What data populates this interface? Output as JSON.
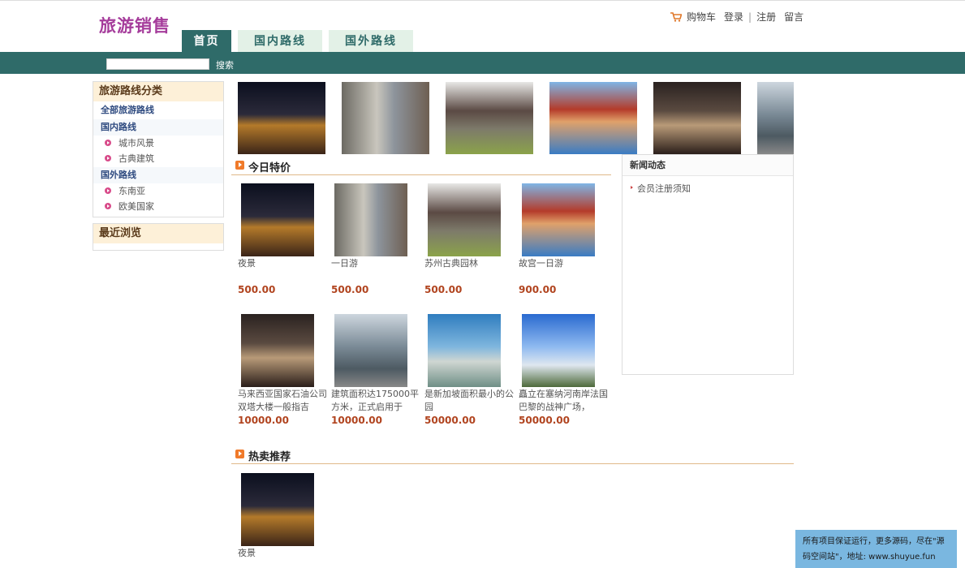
{
  "header": {
    "logo": "旅游销售",
    "cart": "购物车",
    "login": "登录",
    "sep": "|",
    "register": "注册",
    "message": "留言"
  },
  "nav": {
    "home": "首页",
    "domestic": "国内路线",
    "overseas": "国外路线"
  },
  "search": {
    "placeholder": "",
    "button": "搜索"
  },
  "sidebar": {
    "title": "旅游路线分类",
    "all_routes": "全部旅游路线",
    "domestic_group": "国内路线",
    "domestic_items": [
      "城市风景",
      "古典建筑"
    ],
    "overseas_group": "国外路线",
    "overseas_items": [
      "东南亚",
      "欧美国家"
    ],
    "recent_title": "最近浏览"
  },
  "thumbnails": [
    {
      "photo": "night-city"
    },
    {
      "photo": "shopping-street"
    },
    {
      "photo": "classical-garden"
    },
    {
      "photo": "palace-reflection"
    },
    {
      "photo": "twin-towers"
    },
    {
      "photo": "city-buildings"
    }
  ],
  "today_special": {
    "title": "今日特价",
    "products": [
      {
        "name": "夜景",
        "price": "500.00",
        "photo": "night-city"
      },
      {
        "name": "一日游",
        "price": "500.00",
        "photo": "shopping-street"
      },
      {
        "name": "苏州古典园林",
        "price": "500.00",
        "photo": "classical-garden"
      },
      {
        "name": "故宫一日游",
        "price": "900.00",
        "photo": "palace-reflection"
      },
      {
        "name": "马来西亚国家石油公司双塔大楼一般指吉",
        "price": "10000.00",
        "photo": "twin-towers"
      },
      {
        "name": "建筑面积达175000平方米，正式启用于",
        "price": "10000.00",
        "photo": "city-buildings"
      },
      {
        "name": "是新加坡面积最小的公园",
        "price": "50000.00",
        "photo": "merlion"
      },
      {
        "name": "矗立在塞纳河南岸法国巴黎的战神广场，",
        "price": "50000.00",
        "photo": "eiffel-tower"
      }
    ]
  },
  "news": {
    "title": "新闻动态",
    "items": [
      "会员注册须知"
    ]
  },
  "hot": {
    "title": "热卖推荐",
    "products": [
      {
        "name": "夜景",
        "photo": "night-city"
      }
    ]
  },
  "footer_note": "所有项目保证运行，更多源码，尽在\"源码空间站\"，地址: www.shuyue.fun"
}
